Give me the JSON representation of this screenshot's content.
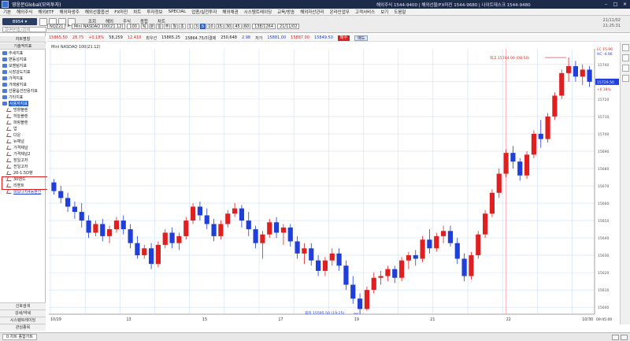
{
  "window": {
    "title": "영웅문Global(모의투자)",
    "contact": "해외주식 1544-9400 | 해외선물/FX마진 1544-9680 | 나이트데스크 1544-9480"
  },
  "menu": [
    "기본",
    "해외주식",
    "해외ETF",
    "해외파생주",
    "해외선물옵션",
    "FX마진",
    "차트",
    "투자정보",
    "SPECIAL",
    "업종/실전투자",
    "해외채권",
    "시스템트레이딩",
    "교육/방송",
    "해외자산관리",
    "온라인업무",
    "고객서비스",
    "보기",
    "도움말"
  ],
  "toolbar": {
    "account": "8954",
    "search_placeholder": "화면번호/검색",
    "buttons": [
      "조회",
      "해외",
      "주식",
      "종합",
      "차트"
    ],
    "date": "21/11/02",
    "time": "21:25:31"
  },
  "chartbar": {
    "symbol_code": "NQZ21",
    "symbol_name": "Mini NASDAQ 100(21.12)",
    "count": "100",
    "period_buttons": [
      "틱",
      "분",
      "일",
      "주",
      "월",
      "초"
    ],
    "minute_buttons": [
      "1",
      "3",
      "5",
      "10",
      "15",
      "30",
      "45",
      "60"
    ],
    "active_minute": "5",
    "view_count": "138/1264",
    "date": "21/11/02"
  },
  "infobar": {
    "price": "15865.50",
    "change": "28.75",
    "change_pct": "+0.18%",
    "volume": "58,259",
    "change2": "12.410",
    "prev_close_label": "최우선",
    "prev_close": "15865.25",
    "ask_bid": "15864.75/미결제",
    "open_interest": "250,648",
    "oi_change": "2.98",
    "low_label": "저가",
    "low": "15881.00",
    "high": "15887.00",
    "last": "15849.50",
    "buy_label": "매수",
    "sell_label": "매도"
  },
  "left_panel": {
    "header": "차트명칭",
    "subheader": "기술적지표",
    "items": [
      {
        "label": "추세지표",
        "type": "folder"
      },
      {
        "label": "변동성지표",
        "type": "folder"
      },
      {
        "label": "모멘텀지표",
        "type": "folder"
      },
      {
        "label": "시장강도지표",
        "type": "folder"
      },
      {
        "label": "가격지표",
        "type": "folder"
      },
      {
        "label": "거래량지표",
        "type": "folder"
      },
      {
        "label": "선물옵션전용지표",
        "type": "folder"
      },
      {
        "label": "기타지표",
        "type": "folder"
      },
      {
        "label": "사용자지표",
        "type": "folder",
        "selected": true
      },
      {
        "label": "방향블렌",
        "type": "indicator"
      },
      {
        "label": "하늘블렌",
        "type": "indicator"
      },
      {
        "label": "파랑블렌",
        "type": "indicator"
      },
      {
        "label": "업",
        "type": "indicator"
      },
      {
        "label": "다운",
        "type": "indicator"
      },
      {
        "label": "뉴채널",
        "type": "indicator"
      },
      {
        "label": "가격채널",
        "type": "indicator"
      },
      {
        "label": "가격채널2",
        "type": "indicator"
      },
      {
        "label": "장일고저",
        "type": "indicator"
      },
      {
        "label": "전일고저",
        "type": "indicator"
      },
      {
        "label": "20-1.5D향",
        "type": "indicator"
      },
      {
        "label": "30밴드",
        "type": "indicator"
      },
      {
        "label": "리벤트",
        "type": "indicator"
      },
      {
        "label": "파보나치4등분선",
        "type": "indicator",
        "link": true
      }
    ],
    "bottom_tabs": [
      "신호검색",
      "강세/약세",
      "시스템트레이딩",
      "관심종목"
    ]
  },
  "taskbar": {
    "tab": "0 차트 종합가트"
  },
  "chart_data": {
    "type": "candlestick",
    "title": "Mini NASDAQ 100(21.12)",
    "y_ticks": [
      15600,
      15610,
      15620,
      15630,
      15640,
      15650,
      15660,
      15670,
      15680,
      15690,
      15700,
      15710,
      15720,
      15730,
      15740
    ],
    "ylim": [
      15596,
      15749
    ],
    "date_labels": [
      "10/29",
      "13",
      "15",
      "17",
      "19",
      "21",
      "22",
      "10/30"
    ],
    "time_label": "09:45:00",
    "current_price": "15729.50",
    "current_change": "+0.18%",
    "max_annotation": "최고 15744.00 (08:50)",
    "min_annotation": "최저 15595.50 (19:25)",
    "corner_legend": [
      "LC 15.96",
      "HC -4.96"
    ],
    "up_color": "#e02020",
    "down_color": "#1f3fd8",
    "candles": [
      [
        15672,
        15674,
        15665,
        15667
      ],
      [
        15667,
        15670,
        15660,
        15663
      ],
      [
        15663,
        15666,
        15655,
        15658
      ],
      [
        15658,
        15661,
        15651,
        15655
      ],
      [
        15655,
        15660,
        15646,
        15650
      ],
      [
        15650,
        15653,
        15640,
        15643
      ],
      [
        15643,
        15650,
        15641,
        15648
      ],
      [
        15648,
        15651,
        15638,
        15641
      ],
      [
        15641,
        15647,
        15637,
        15645
      ],
      [
        15645,
        15652,
        15643,
        15650
      ],
      [
        15650,
        15653,
        15642,
        15645
      ],
      [
        15645,
        15648,
        15634,
        15637
      ],
      [
        15637,
        15641,
        15628,
        15630
      ],
      [
        15630,
        15636,
        15628,
        15634
      ],
      [
        15634,
        15637,
        15622,
        15625
      ],
      [
        15625,
        15638,
        15623,
        15636
      ],
      [
        15636,
        15645,
        15634,
        15643
      ],
      [
        15643,
        15646,
        15634,
        15637
      ],
      [
        15637,
        15643,
        15633,
        15641
      ],
      [
        15641,
        15652,
        15639,
        15650
      ],
      [
        15650,
        15660,
        15648,
        15658
      ],
      [
        15658,
        15661,
        15650,
        15653
      ],
      [
        15653,
        15657,
        15645,
        15648
      ],
      [
        15648,
        15651,
        15638,
        15641
      ],
      [
        15641,
        15650,
        15639,
        15648
      ],
      [
        15648,
        15656,
        15646,
        15654
      ],
      [
        15654,
        15660,
        15652,
        15657
      ],
      [
        15657,
        15659,
        15646,
        15650
      ],
      [
        15650,
        15655,
        15641,
        15645
      ],
      [
        15645,
        15647,
        15634,
        15637
      ],
      [
        15637,
        15644,
        15628,
        15642
      ],
      [
        15642,
        15651,
        15640,
        15649
      ],
      [
        15649,
        15652,
        15640,
        15643
      ],
      [
        15643,
        15648,
        15636,
        15646
      ],
      [
        15646,
        15648,
        15635,
        15638
      ],
      [
        15638,
        15641,
        15628,
        15631
      ],
      [
        15631,
        15637,
        15625,
        15634
      ],
      [
        15634,
        15637,
        15624,
        15627
      ],
      [
        15627,
        15630,
        15618,
        15621
      ],
      [
        15621,
        15629,
        15618,
        15627
      ],
      [
        15627,
        15634,
        15624,
        15631
      ],
      [
        15631,
        15634,
        15621,
        15624
      ],
      [
        15624,
        15627,
        15610,
        15613
      ],
      [
        15613,
        15618,
        15602,
        15605
      ],
      [
        15605,
        15608,
        15596,
        15599
      ],
      [
        15599,
        15612,
        15598,
        15610
      ],
      [
        15610,
        15620,
        15608,
        15617
      ],
      [
        15617,
        15621,
        15613,
        15618
      ],
      [
        15618,
        15624,
        15615,
        15622
      ],
      [
        15622,
        15624,
        15614,
        15617
      ],
      [
        15617,
        15629,
        15615,
        15627
      ],
      [
        15627,
        15632,
        15622,
        15630
      ],
      [
        15630,
        15633,
        15624,
        15628
      ],
      [
        15628,
        15641,
        15626,
        15639
      ],
      [
        15639,
        15645,
        15631,
        15634
      ],
      [
        15634,
        15643,
        15632,
        15641
      ],
      [
        15641,
        15647,
        15637,
        15644
      ],
      [
        15644,
        15647,
        15635,
        15637
      ],
      [
        15637,
        15640,
        15625,
        15628
      ],
      [
        15628,
        15631,
        15615,
        15618
      ],
      [
        15618,
        15632,
        15616,
        15630
      ],
      [
        15630,
        15644,
        15628,
        15642
      ],
      [
        15642,
        15656,
        15640,
        15654
      ],
      [
        15654,
        15668,
        15652,
        15666
      ],
      [
        15666,
        15680,
        15663,
        15677
      ],
      [
        15677,
        15691,
        15675,
        15689
      ],
      [
        15689,
        15693,
        15680,
        15684
      ],
      [
        15684,
        15686,
        15673,
        15676
      ],
      [
        15676,
        15690,
        15674,
        15688
      ],
      [
        15688,
        15702,
        15686,
        15700
      ],
      [
        15700,
        15708,
        15692,
        15697
      ],
      [
        15697,
        15712,
        15695,
        15710
      ],
      [
        15710,
        15724,
        15708,
        15722
      ],
      [
        15722,
        15737,
        15720,
        15735
      ],
      [
        15735,
        15744,
        15730,
        15739
      ],
      [
        15739,
        15742,
        15730,
        15733
      ],
      [
        15733,
        15740,
        15728,
        15737
      ],
      [
        15737,
        15739,
        15727,
        15730
      ]
    ]
  }
}
